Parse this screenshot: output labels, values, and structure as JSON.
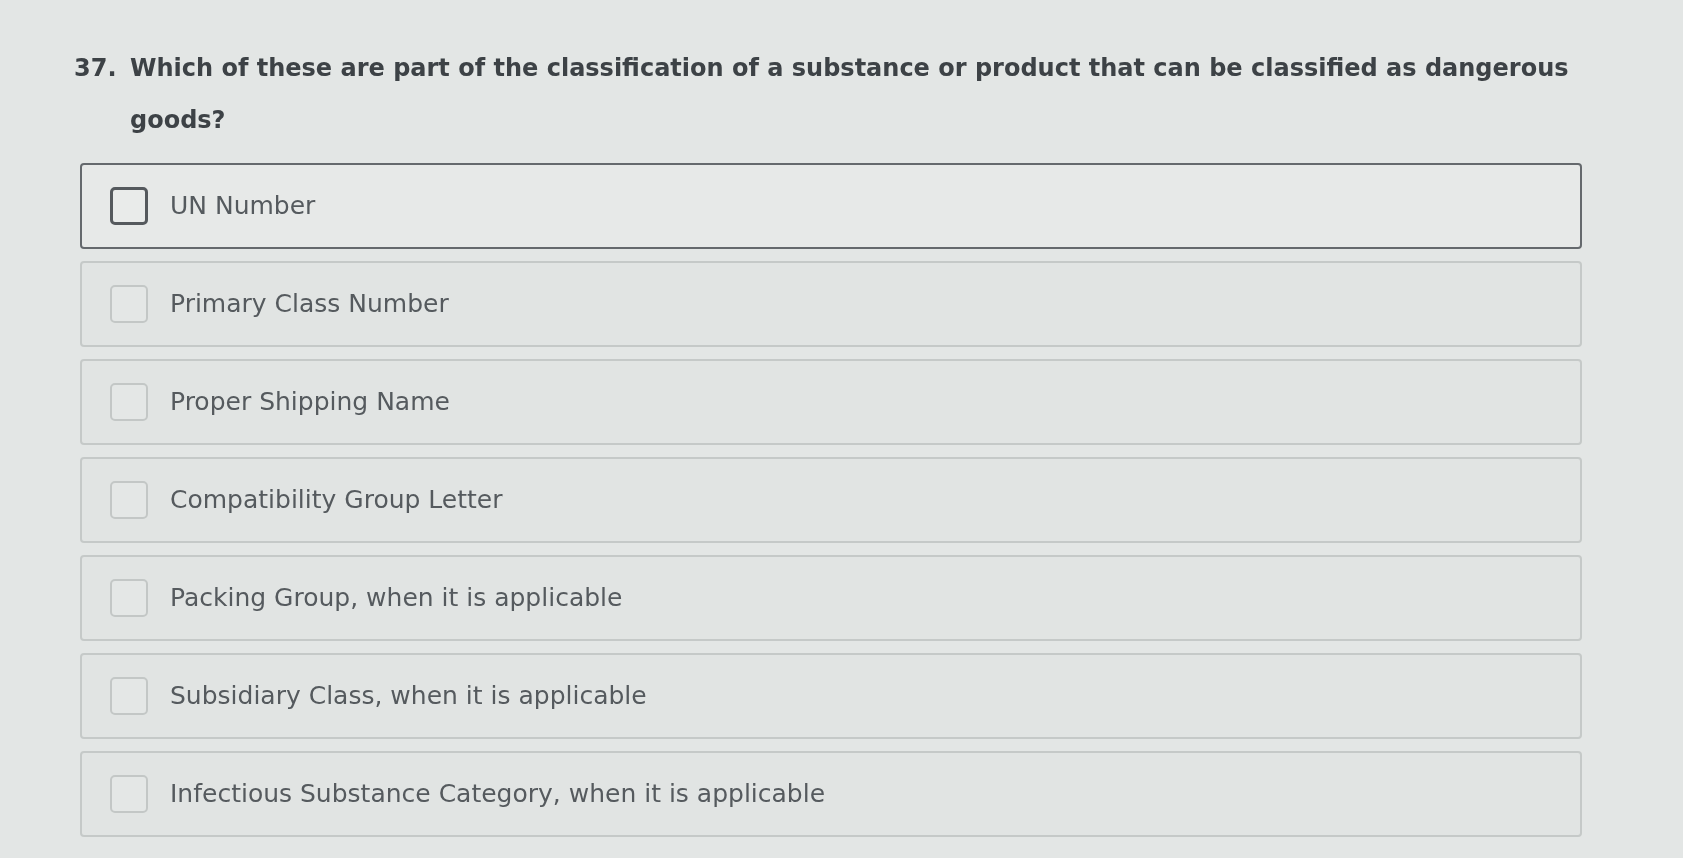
{
  "question": {
    "number": "37.",
    "text": "Which of these are part of the classification of a substance or product that can be classified as dangerous goods?"
  },
  "options": [
    {
      "label": "UN Number",
      "checked": false,
      "focused": true
    },
    {
      "label": "Primary Class Number",
      "checked": false,
      "focused": false
    },
    {
      "label": "Proper Shipping Name",
      "checked": false,
      "focused": false
    },
    {
      "label": "Compatibility Group Letter",
      "checked": false,
      "focused": false
    },
    {
      "label": "Packing Group, when it is applicable",
      "checked": false,
      "focused": false
    },
    {
      "label": "Subsidiary Class, when it is applicable",
      "checked": false,
      "focused": false
    },
    {
      "label": "Infectious Substance Category, when it is applicable",
      "checked": false,
      "focused": false
    }
  ]
}
